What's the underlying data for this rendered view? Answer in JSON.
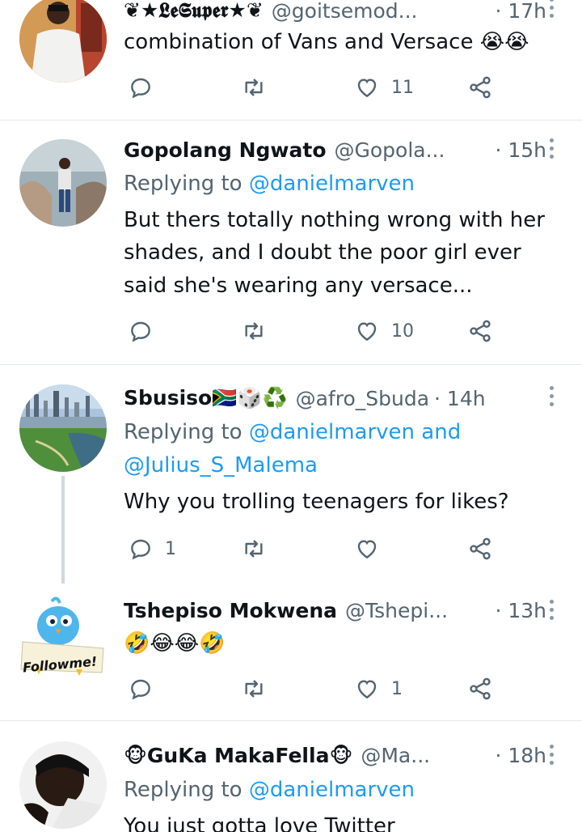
{
  "tweets": [
    {
      "name": "❦★𝕷𝖊𝕾𝖚𝖕𝖊𝖗★❦",
      "handle": "@goitsemod...",
      "time": "· 17h",
      "text_lines": [
        "combination of Vans and Versace 😭😭"
      ],
      "replies": "",
      "retweets": "",
      "likes": "11"
    },
    {
      "name": "Gopolang Ngwato",
      "handle": "@Gopola...",
      "time": "· 15h",
      "replying_prefix": "Replying to ",
      "replying_to": "@danielmarven",
      "text_lines": [
        "But thers totally nothing wrong with her",
        "shades, and I doubt the poor girl ever",
        "said she's wearing any versace..."
      ],
      "replies": "",
      "retweets": "",
      "likes": "10"
    },
    {
      "name": "Sbusiso🇿🇦🎲♻️",
      "handle": "@afro_Sbuda",
      "time": "· 14h",
      "replying_prefix": "Replying to ",
      "replying_to": "@danielmarven and",
      "replying_to_2": "@Julius_S_Malema",
      "text_lines": [
        "Why you trolling teenagers for likes?"
      ],
      "replies": "1",
      "retweets": "",
      "likes": ""
    },
    {
      "name": "Tshepiso Mokwena",
      "handle": "@Tshepi...",
      "time": "· 13h",
      "text_lines": [
        "🤣😂😂🤣"
      ],
      "avatar_text": "Followme!",
      "replies": "",
      "retweets": "",
      "likes": "1"
    },
    {
      "name": "🐵GuKa MakaFella🐵",
      "handle": "@Ma...",
      "time": "· 18h",
      "replying_prefix": "Replying to ",
      "replying_to": "@danielmarven",
      "text_lines": [
        "You just gotta love Twitter"
      ]
    }
  ],
  "icons": {
    "reply": "reply-icon",
    "retweet": "retweet-icon",
    "like": "heart-icon",
    "share": "share-icon",
    "more": "more-icon"
  },
  "colors": {
    "link": "#1d9bf0",
    "muted": "#536471",
    "divider": "#e3e7ea"
  }
}
